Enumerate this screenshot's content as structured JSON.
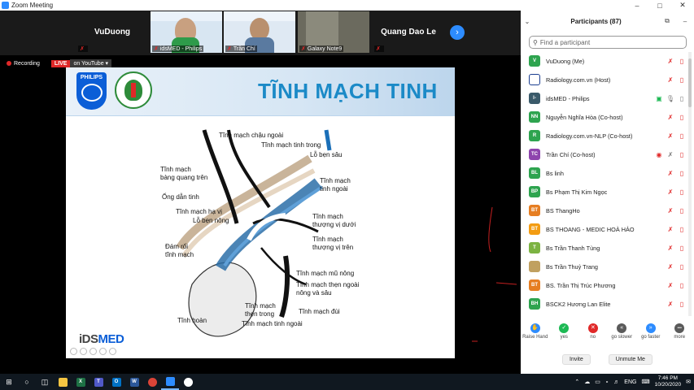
{
  "window": {
    "title": "Zoom Meeting",
    "minimize": "–",
    "maximize": "□",
    "close": "✕"
  },
  "strip": {
    "tiles": [
      {
        "name": "VuDuong",
        "label": ""
      },
      {
        "name": "",
        "label": "idsMED - Philips"
      },
      {
        "name": "",
        "label": "Trần Chí"
      },
      {
        "name": "",
        "label": "Galaxy Note9"
      },
      {
        "name": "Quang Dao Le",
        "label": ""
      }
    ],
    "next": "›"
  },
  "recording": {
    "label": "Recording",
    "live": "LIVE",
    "stream": "on YouTube ▾"
  },
  "slide": {
    "brand": "PHILIPS",
    "title": "TĨNH MẠCH TINH",
    "logo_text": "iDS",
    "logo_text2": "MED",
    "labels": [
      "Tĩnh mạch chậu ngoài",
      "Tĩnh mạch tinh trong",
      "Lỗ bẹn sâu",
      "Tĩnh mạch",
      "bàng quang trên",
      "Tĩnh mạch",
      "tinh ngoài",
      "Ống dẫn tinh",
      "Tĩnh mạch hạ vị",
      "Lỗ bẹn nông",
      "Tĩnh mạch",
      "thượng vị dưới",
      "Đám rối",
      "tĩnh mạch",
      "Tĩnh mạch",
      "thượng vị trên",
      "Tĩnh mạch mũ nông",
      "Tĩnh mạch thẹn ngoài",
      "nông và sâu",
      "Tĩnh hoàn",
      "Tĩnh mạch",
      "thẹn trong",
      "Tĩnh mạch đùi",
      "Tĩnh mạch tinh ngoài"
    ]
  },
  "panel": {
    "title": "Participants (87)",
    "search_placeholder": "Find a participant",
    "participants": [
      {
        "initials": "V",
        "color": "#2ea44f",
        "name": "VuDuong (Me)"
      },
      {
        "initials": "",
        "color": "#1a3d8f",
        "name": "Radiology.com.vn (Host)"
      },
      {
        "initials": "I-",
        "color": "#3a5a6a",
        "name": "idsMED - Philips"
      },
      {
        "initials": "NN",
        "color": "#2ea44f",
        "name": "Nguyễn Nghĩa Hòa (Co-host)"
      },
      {
        "initials": "R",
        "color": "#2ea44f",
        "name": "Radiology.com.vn-NLP (Co-host)"
      },
      {
        "initials": "TC",
        "color": "#8e44ad",
        "name": "Trần Chí (Co-host)"
      },
      {
        "initials": "BL",
        "color": "#2ea44f",
        "name": "Bs linh"
      },
      {
        "initials": "BP",
        "color": "#2ea44f",
        "name": "Bs Phạm Thị Kim Ngọc"
      },
      {
        "initials": "BT",
        "color": "#e67e22",
        "name": "BS ThangHo"
      },
      {
        "initials": "BT",
        "color": "#f39c12",
        "name": "BS THOANG - MEDIC HOÀ HẢO"
      },
      {
        "initials": "T",
        "color": "#7cb342",
        "name": "Bs Trần Thanh Tùng"
      },
      {
        "initials": "",
        "color": "#c0a060",
        "name": "Bs Trần Thuỷ Trang"
      },
      {
        "initials": "BT",
        "color": "#e67e22",
        "name": "BS. Trần Thị Trúc Phương"
      },
      {
        "initials": "BH",
        "color": "#2ea44f",
        "name": "BSCK2 Hương Lan Elite"
      }
    ],
    "reactions": [
      {
        "label": "Raise Hand",
        "icon": "✋",
        "color": "#2d8cff"
      },
      {
        "label": "yes",
        "icon": "✓",
        "color": "#1db954"
      },
      {
        "label": "no",
        "icon": "✕",
        "color": "#e02828"
      },
      {
        "label": "go slower",
        "icon": "«",
        "color": "#5a5a5a"
      },
      {
        "label": "go faster",
        "icon": "»",
        "color": "#2d8cff"
      },
      {
        "label": "more",
        "icon": "•••",
        "color": "#5a5a5a"
      }
    ],
    "invite": "Invite",
    "unmute": "Unmute Me"
  },
  "taskbar": {
    "lang": "ENG",
    "time": "7:46 PM",
    "date": "10/20/2020"
  }
}
